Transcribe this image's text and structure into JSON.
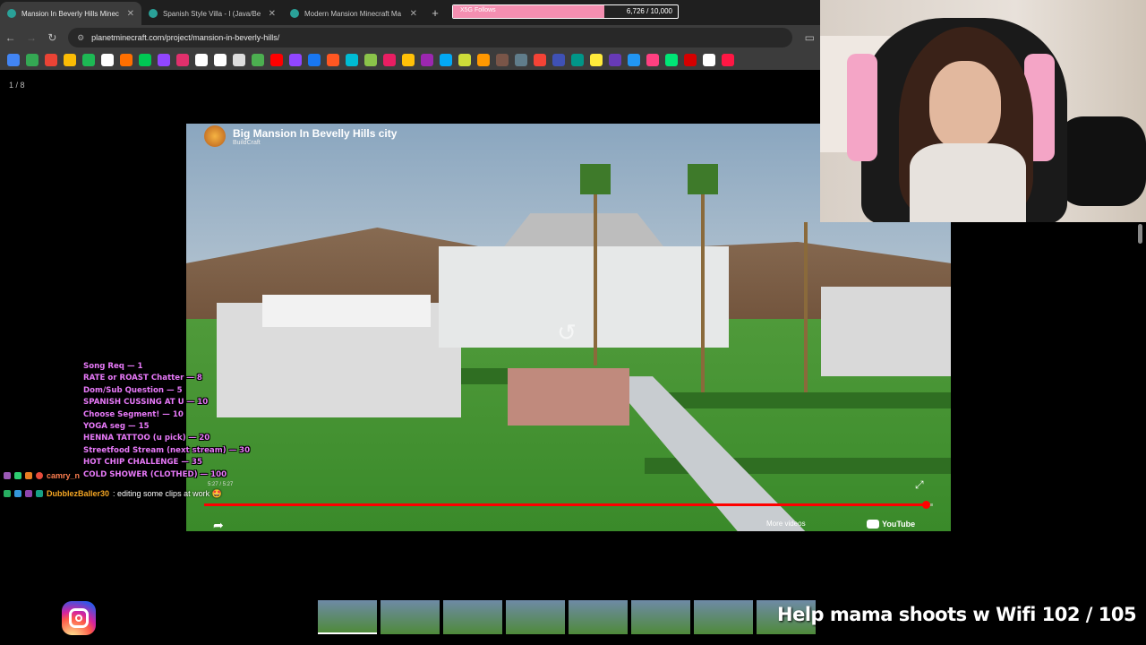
{
  "browser": {
    "tabs": [
      {
        "label": "Mansion In Beverly Hills Minec",
        "active": true
      },
      {
        "label": "Spanish Style Villa - I (Java/Be",
        "active": false
      },
      {
        "label": "Modern Mansion Minecraft Ma",
        "active": false
      }
    ],
    "url": "planetminecraft.com/project/mansion-in-beverly-hills/"
  },
  "follow_goal": {
    "label": "X5G Follows",
    "count": "6,726 / 10,000",
    "progress": 0.6726,
    "color": "#f48fb1"
  },
  "page_counter": "1 / 8",
  "video": {
    "title": "Big Mansion In Bevelly Hills city",
    "channel": "BuildCraft",
    "time": "5:27 / 5:27",
    "progress": 0.99,
    "more_videos": "More videos",
    "platform": "YouTube"
  },
  "menu": [
    "Song Req — 1",
    "RATE or ROAST Chatter — 8",
    "Dom/Sub Question — 5",
    "SPANISH CUSSING AT U — 10",
    "Choose Segment! — 10",
    "YOGA seg — 15",
    "HENNA TATTOO (u pick) — 20",
    "Streetfood Stream (next stream) — 30",
    "HOT CHIP CHALLENGE — 35",
    "COLD SHOWER (CLOTHED) — 100"
  ],
  "chat": [
    {
      "user": "camry_n",
      "message": "",
      "color": "#ff7f50"
    },
    {
      "user": "DubblezBaller30",
      "message": ": editing some clips at work 🤩",
      "color": "#f5a623"
    }
  ],
  "goal_text": "Help mama shoots w Wifi  102 / 105",
  "thumbnails_count": 8,
  "accent_colors": {
    "youtube_red": "#ff0000",
    "menu_pink": "#e879f9"
  }
}
